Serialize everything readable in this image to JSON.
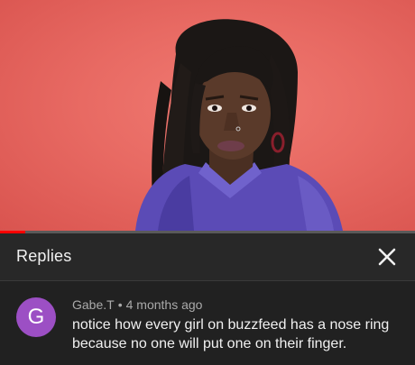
{
  "video": {
    "progress_fraction": 0.06
  },
  "replies_panel": {
    "title": "Replies",
    "close_icon": "close-icon"
  },
  "comment": {
    "avatar_letter": "G",
    "avatar_color": "#9c4fc4",
    "author": "Gabe.T",
    "separator": "•",
    "timestamp": "4 months ago",
    "text": "notice how every girl on buzzfeed has a nose ring because no one will put one on their finger."
  }
}
